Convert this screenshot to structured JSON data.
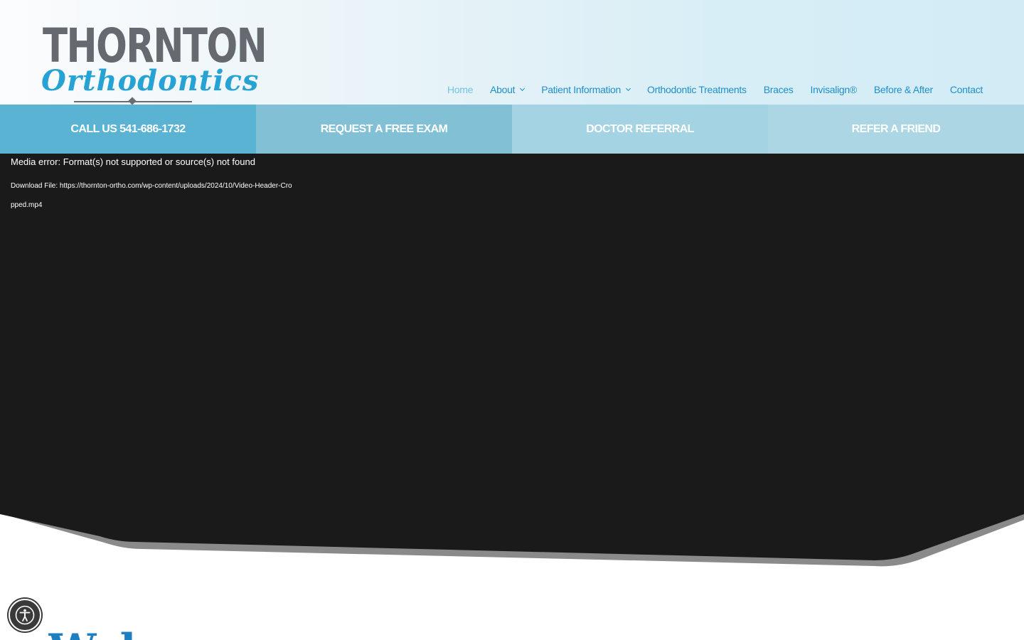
{
  "logo": {
    "line1": "THORNTON",
    "line2": "Orthodontics"
  },
  "nav": {
    "items": [
      {
        "label": "Home",
        "active": true,
        "dropdown": false
      },
      {
        "label": "About",
        "active": false,
        "dropdown": true
      },
      {
        "label": "Patient Information",
        "active": false,
        "dropdown": true
      },
      {
        "label": "Orthodontic Treatments",
        "active": false,
        "dropdown": false
      },
      {
        "label": "Braces",
        "active": false,
        "dropdown": false
      },
      {
        "label": "Invisalign®",
        "active": false,
        "dropdown": false
      },
      {
        "label": "Before & After",
        "active": false,
        "dropdown": false
      },
      {
        "label": "Contact",
        "active": false,
        "dropdown": false
      }
    ]
  },
  "cta": {
    "call": "CALL US 541-686-1732",
    "exam": "REQUEST A FREE EXAM",
    "referral": "DOCTOR REFERRAL",
    "friend": "REFER A FRIEND"
  },
  "video": {
    "error_text": "Media error: Format(s) not supported or source(s) not found",
    "download_label": "Download File: ",
    "download_url": "https://thornton-ortho.com/wp-content/uploads/2024/10/Video-Header-Cropped.mp4"
  },
  "welcome": {
    "heading": "Wel"
  },
  "colors": {
    "brand_blue": "#1f8fcd",
    "logo_gray": "#666a70",
    "video_bg": "#1a1a1a"
  },
  "icons": {
    "accessibility": "accessibility-icon",
    "dropdown": "chevron-down-icon"
  }
}
